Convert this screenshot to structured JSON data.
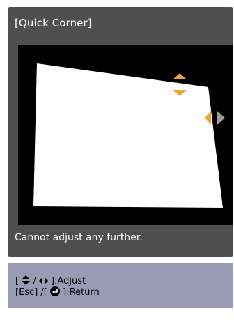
{
  "osd": {
    "title": "[Quick Corner]",
    "message": "Cannot adjust any further.",
    "preview": {
      "corner_arrows": {
        "vertical_icon": "up-down-arrows-icon",
        "horizontal_icon": "left-right-arrows-icon",
        "active_color": "#f0a232",
        "disabled_color": "#9a9a9a"
      }
    }
  },
  "help": {
    "adjust_open": "[",
    "adjust_sep": "/",
    "adjust_label": "]:Adjust",
    "return_open": "[Esc] /[",
    "return_label": "]:Return",
    "icons": [
      "up-down-triangle-icon",
      "left-right-triangle-icon",
      "enter-button-icon"
    ]
  },
  "colors": {
    "panel": "#4f4f4f",
    "help_panel": "#9a9ab5",
    "screen": "#ffffff",
    "preview_bg": "#000000"
  }
}
